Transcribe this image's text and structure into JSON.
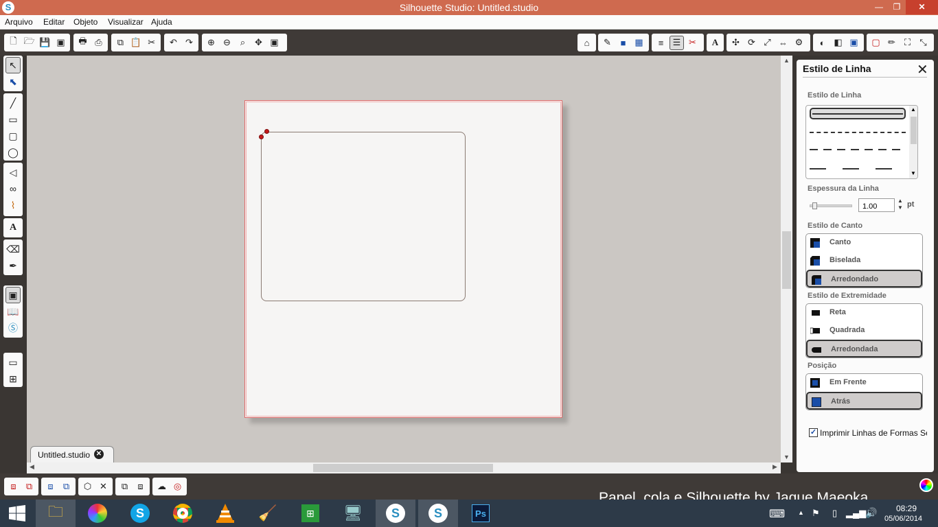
{
  "window": {
    "title": "Silhouette Studio: Untitled.studio"
  },
  "menu": [
    "Arquivo",
    "Editar",
    "Objeto",
    "Visualizar",
    "Ajuda"
  ],
  "document_tab": {
    "label": "Untitled.studio"
  },
  "panel": {
    "title": "Estilo de Linha",
    "line_style_label": "Estilo de Linha",
    "thickness_label": "Espessura da Linha",
    "thickness_value": "1.00",
    "thickness_unit": "pt",
    "corner_label": "Estilo de Canto",
    "corner_options": [
      "Canto",
      "Biselada",
      "Arredondado"
    ],
    "corner_selected": "Arredondado",
    "end_label": "Estilo de Extremidade",
    "end_options": [
      "Reta",
      "Quadrada",
      "Arredondada"
    ],
    "end_selected": "Arredondada",
    "position_label": "Posição",
    "position_options": [
      "Em Frente",
      "Atrás"
    ],
    "position_selected": "Atrás",
    "print_checkbox": {
      "label": "Imprimir Linhas de Formas Se",
      "checked": true
    }
  },
  "watermark": "Papel, cola e Silhouette by Jaque Maeoka",
  "clock": {
    "time": "08:29",
    "date": "05/06/2014"
  },
  "colors": {
    "titlebar": "#cf6a4f",
    "workspace": "#cbc7c3",
    "accent": "#1a4ea8",
    "node": "#c41a1a"
  }
}
